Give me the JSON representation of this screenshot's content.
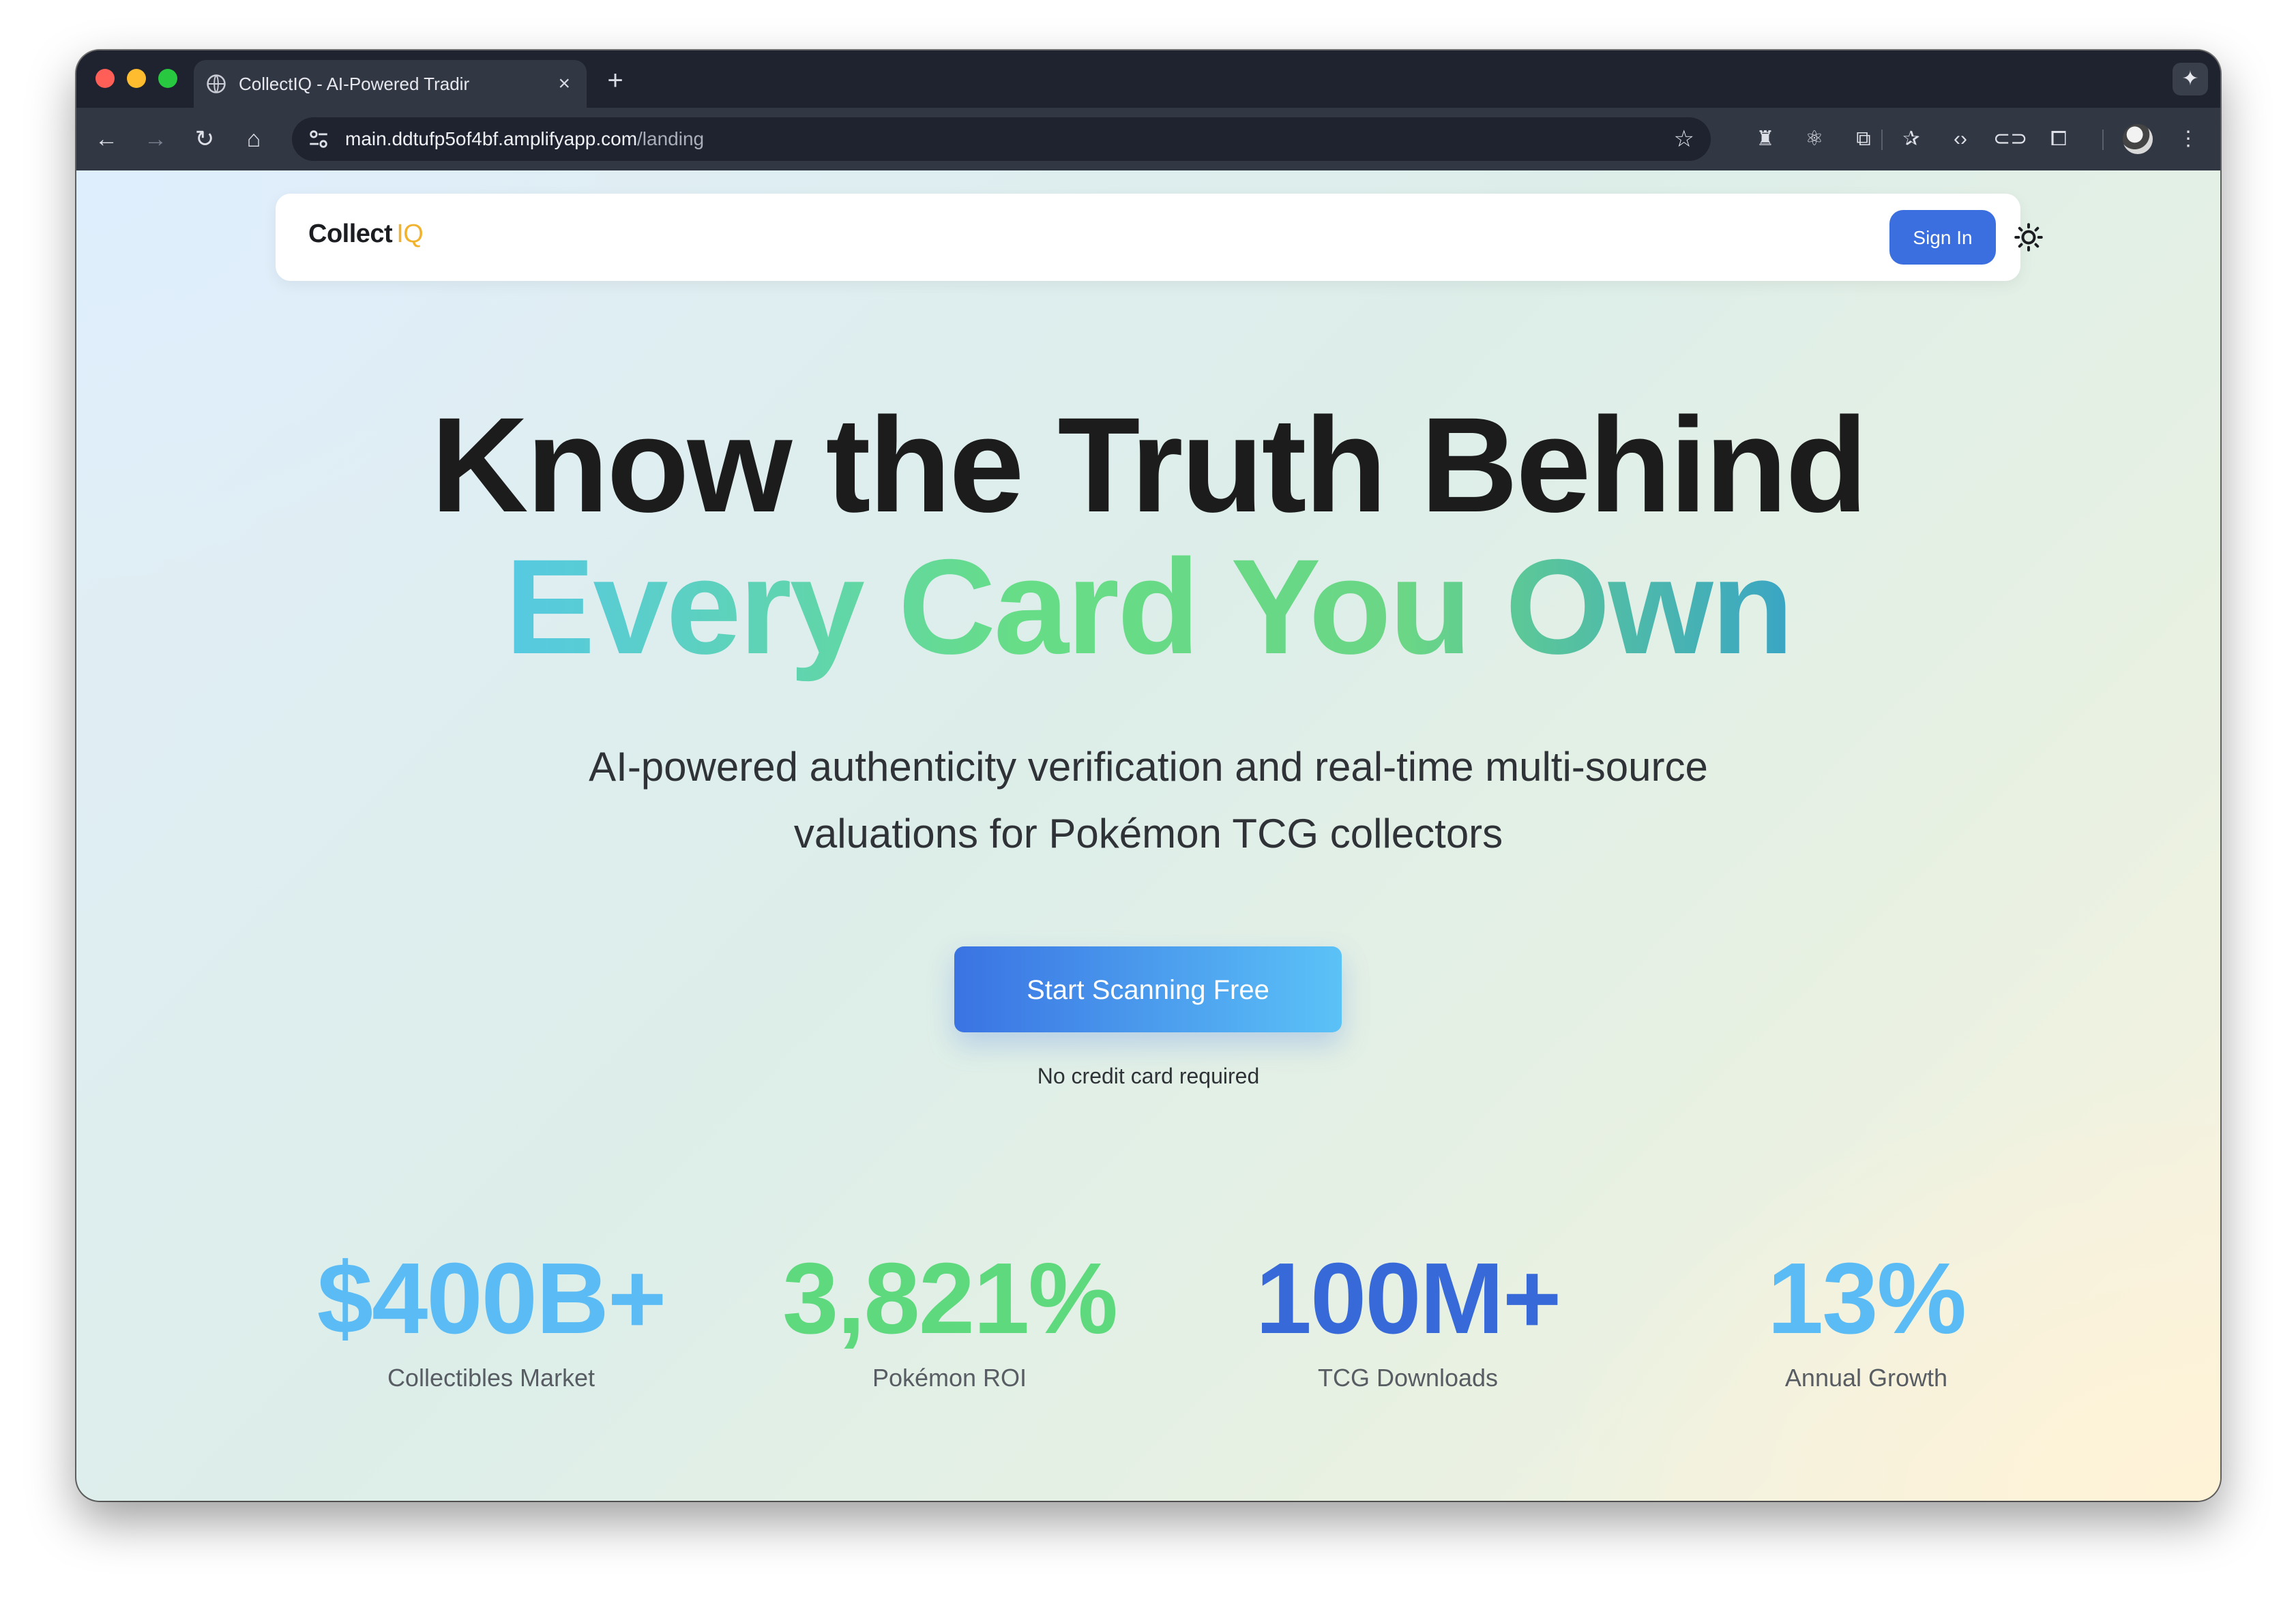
{
  "browser": {
    "tab_title": "CollectIQ - AI-Powered Tradir",
    "tab_close": "×",
    "new_tab": "+",
    "gemini_icon": "✦",
    "url_host": "main.ddtufp5of4bf.amplifyapp.com",
    "url_path": "/landing",
    "bookmark_icon": "☆"
  },
  "nav": {
    "logo_main": "Collect",
    "logo_accent": "IQ",
    "signin_label": "Sign In"
  },
  "hero": {
    "line1": "Know the Truth Behind",
    "line2": "Every Card You Own",
    "subtitle_line1": "AI-powered authenticity verification and real-time multi-source",
    "subtitle_line2": "valuations for Pokémon TCG collectors",
    "cta_label": "Start Scanning Free",
    "cta_note": "No credit card required"
  },
  "stats": [
    {
      "value": "$400B+",
      "label": "Collectibles Market",
      "color": "#5bbcf5"
    },
    {
      "value": "3,821%",
      "label": "Pokémon ROI",
      "color": "#5fd97e"
    },
    {
      "value": "100M+",
      "label": "TCG Downloads",
      "color": "#3769d8"
    },
    {
      "value": "13%",
      "label": "Annual Growth",
      "color": "#5bbcf5"
    }
  ],
  "colors": {
    "accent_blue": "#3b6fe0",
    "logo_gold": "#f1b32e"
  }
}
